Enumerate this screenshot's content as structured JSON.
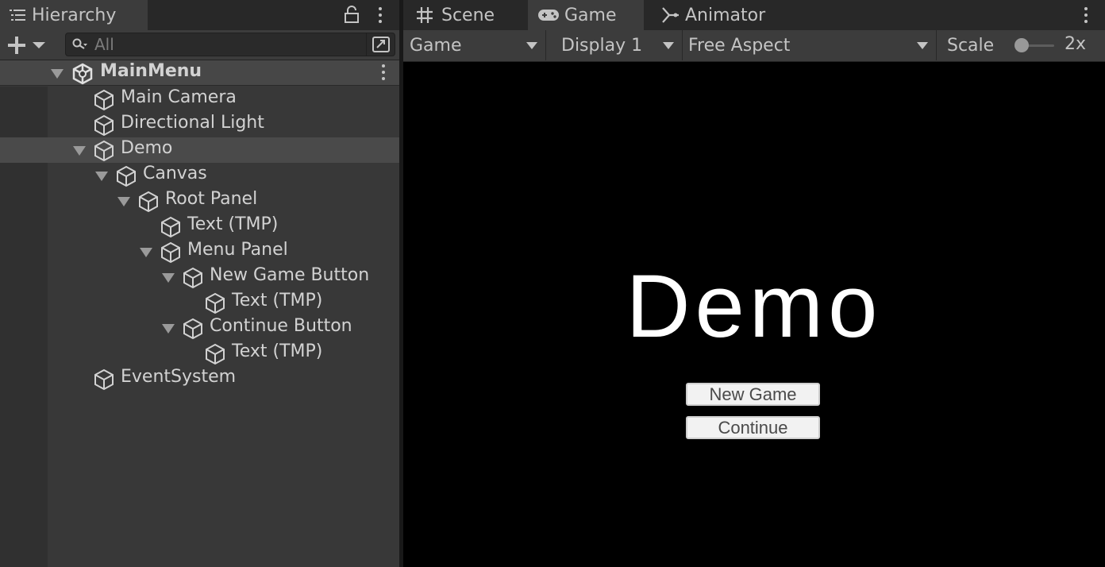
{
  "hierarchy": {
    "tab_label": "Hierarchy",
    "search_placeholder": "All",
    "items": [
      {
        "label": "MainMenu"
      },
      {
        "label": "Main Camera"
      },
      {
        "label": "Directional Light"
      },
      {
        "label": "Demo"
      },
      {
        "label": "Canvas"
      },
      {
        "label": "Root Panel"
      },
      {
        "label": "Text (TMP)"
      },
      {
        "label": "Menu Panel"
      },
      {
        "label": "New Game Button"
      },
      {
        "label": "Text (TMP)"
      },
      {
        "label": "Continue Button"
      },
      {
        "label": "Text (TMP)"
      },
      {
        "label": "EventSystem"
      }
    ]
  },
  "main_tabs": [
    {
      "label": "Scene",
      "icon": "grid-icon"
    },
    {
      "label": "Game",
      "icon": "gamepad-icon"
    },
    {
      "label": "Animator",
      "icon": "animator-icon"
    }
  ],
  "game_toolbar": {
    "view_mode": "Game",
    "display": "Display 1",
    "aspect": "Free Aspect",
    "scale_label": "Scale",
    "scale_value": "2x"
  },
  "game_view": {
    "title": "Demo",
    "buttons": [
      "New Game",
      "Continue"
    ]
  },
  "colors": {
    "panel_bg": "#383838",
    "tab_bg": "#282828",
    "game_bg": "#000000",
    "text": "#c4c4c4"
  }
}
